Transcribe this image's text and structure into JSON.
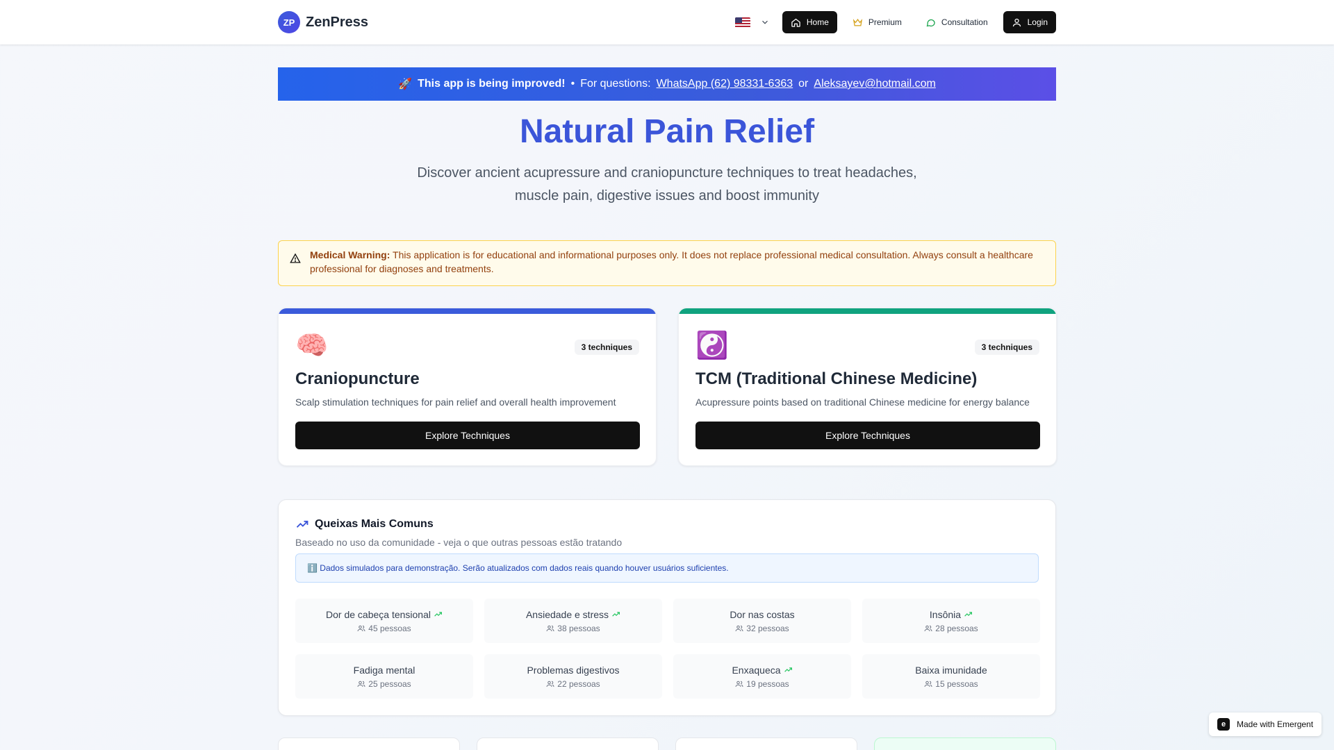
{
  "header": {
    "logo_text": "ZP",
    "brand": "ZenPress",
    "nav": {
      "home": "Home",
      "premium": "Premium",
      "consultation": "Consultation",
      "login": "Login"
    }
  },
  "banner": {
    "rocket": "🚀",
    "headline": "This app is being improved!",
    "bullet": "•",
    "prefix": "For questions:",
    "whatsapp": "WhatsApp (62) 98331-6363",
    "or": "or",
    "email": "Aleksayev@hotmail.com"
  },
  "hero": {
    "title": "Natural Pain Relief",
    "subtitle": "Discover ancient acupressure and craniopuncture techniques to treat headaches, muscle pain, digestive issues and boost immunity"
  },
  "warning": {
    "label": "Medical Warning:",
    "text": "This application is for educational and informational purposes only. It does not replace professional medical consultation. Always consult a healthcare professional for diagnoses and treatments."
  },
  "cards": [
    {
      "emoji": "🧠",
      "badge": "3 techniques",
      "title": "Craniopuncture",
      "description": "Scalp stimulation techniques for pain relief and overall health improvement",
      "cta": "Explore Techniques",
      "accent": "#3b5bdb"
    },
    {
      "emoji": "☯️",
      "badge": "3 techniques",
      "title": "TCM (Traditional Chinese Medicine)",
      "description": "Acupressure points based on traditional Chinese medicine for energy balance",
      "cta": "Explore Techniques",
      "accent": "#10a37f"
    }
  ],
  "complaints": {
    "title": "Queixas Mais Comuns",
    "subtitle": "Baseado no uso da comunidade - veja o que outras pessoas estão tratando",
    "info": "ℹ️ Dados simulados para demonstração. Serão atualizados com dados reais quando houver usuários suficientes.",
    "items": [
      {
        "name": "Dor de cabeça tensional",
        "count": "45 pessoas",
        "trending": true
      },
      {
        "name": "Ansiedade e stress",
        "count": "38 pessoas",
        "trending": true
      },
      {
        "name": "Dor nas costas",
        "count": "32 pessoas",
        "trending": false
      },
      {
        "name": "Insônia",
        "count": "28 pessoas",
        "trending": true
      },
      {
        "name": "Fadiga mental",
        "count": "25 pessoas",
        "trending": false
      },
      {
        "name": "Problemas digestivos",
        "count": "22 pessoas",
        "trending": false
      },
      {
        "name": "Enxaqueca",
        "count": "19 pessoas",
        "trending": true
      },
      {
        "name": "Baixa imunidade",
        "count": "15 pessoas",
        "trending": false
      }
    ]
  },
  "made_with": "Made with Emergent",
  "colors": {
    "primary": "#3b55d9",
    "dark": "#111111",
    "trend": "#22c55e",
    "warning_text": "#92400e"
  }
}
